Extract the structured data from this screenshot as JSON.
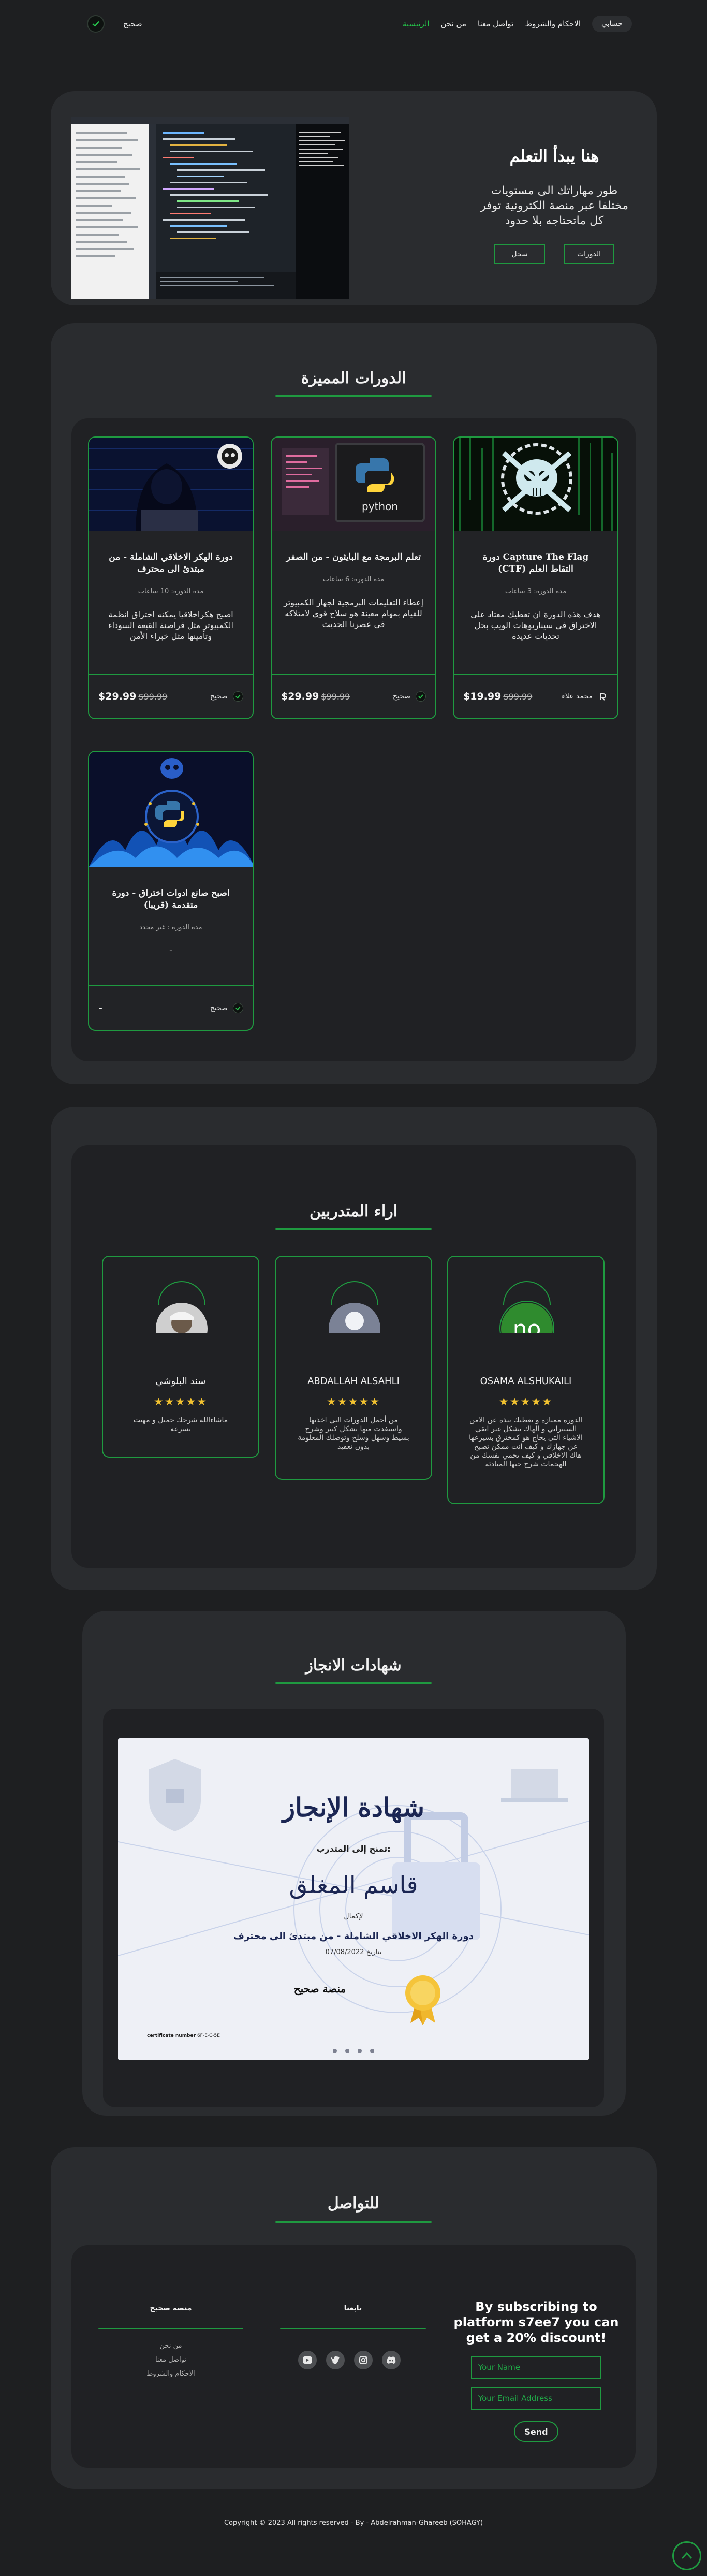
{
  "nav": {
    "brand_name": "صحيح",
    "links": [
      "الرئيسية",
      "من نحن",
      "تواصل معنا",
      "الاحكام والشروط"
    ],
    "account_label": "حسابي"
  },
  "hero": {
    "title": "هنا يبدأ التعلم",
    "description": "طور مهاراتك الى مستويات مختلفا عبر منصة الكترونية توفر كل ماتحتاجه بلا حدود",
    "register_label": "سجل",
    "courses_label": "الدورات"
  },
  "featured": {
    "title": "الدورات المميزة",
    "courses": [
      {
        "title": "دورة Capture The Flag (CTF) التقاط العلم",
        "duration": "مدة الدورة: 3 ساعات",
        "description": "هدف هذه الدورة ان تعطيك معتاد على الاختراق في سيناريوهات الويب بحل تحديات عديدة",
        "price": "$19.99",
        "old_price": "$99.99",
        "author": "محمد علاء"
      },
      {
        "title": "تعلم البرمجة مع البايثون - من الصفر",
        "duration": "مدة الدورة: 6 ساعات",
        "description": "إعطاء التعليمات البرمجية لجهاز الكمبيوتر للقيام بمهام معينة هو سلاح قوي لامتلاكه في عصرنا الحديث",
        "price": "$29.99",
        "old_price": "$99.99",
        "author": "صحيح"
      },
      {
        "title": "دورة الهكر الاخلاقي الشاملة - من مبتدئ الى محترف",
        "duration": "مدة الدورة: 10 ساعات",
        "description": "اصبح هكراخلاقيا يمكنه اختراق انظمة الكمبيوتر مثل قراصنة القبعة السوداء وتأمينها مثل خبراء الأمن",
        "price": "$29.99",
        "old_price": "$99.99",
        "author": "صحيح"
      },
      {
        "title": "اصبح صانع ادوات اختراق - دورة متقدمة (قريبا)",
        "duration": "مدة الدورة : غير محدد",
        "description": "-",
        "price": "-",
        "old_price": "",
        "author": "صحيح"
      }
    ]
  },
  "reviews": {
    "title": "اراء المتدربين",
    "items": [
      {
        "name": "OSAMA ALSHUKAILI",
        "avatar_text": "no",
        "stars": "★★★★★",
        "text": "الدورة ممتازة و تعطيك نبذه عن الامن السيبراني و الهاك بشكل غير ابقي الاشياء التي يحاج هو كمخترق بسيرعها عن جهازك و كيف انت ممكن تصبح هاك الاخلاقي و كيف تحمي نفسك من الهجمات شرح جيها المبادئة"
      },
      {
        "name": "ABDALLAH ALSAHLI",
        "avatar_text": "",
        "stars": "★★★★★",
        "text": "من أجمل الدورات التي اخذتها واستفدت منها بشكل كبير وشرح بسيط وسهل وسلخ وتوصلك المعلومة بدون تعقيد"
      },
      {
        "name": "سند البلوشي",
        "avatar_text": "",
        "stars": "★★★★★",
        "text": "ماشاءالله شرحك جميل و مهيت بسرعه"
      }
    ]
  },
  "certificates": {
    "title": "شهادات الانجاز",
    "cert_heading": "شهادة الإنجاز",
    "granted_to": "تمنح إلى المتدرب:",
    "trainee_name": "قاسم المغلق",
    "for_completing": "لإكمال",
    "course_name": "دورة الهكر الاخلاقي الشاملة - من مبتدئ الى محترف",
    "date_label": "بتاريخ",
    "date": "07/08/2022",
    "platform": "منصة صحيح",
    "certificate_number_label": "certificate number",
    "certificate_number": "6F-E-C-5E"
  },
  "contact": {
    "title": "للتواصل",
    "platform_col_title": "منصة صحيح",
    "platform_links": [
      "من نحن",
      "تواصل معنا",
      "الاحكام والشروط"
    ],
    "follow_col_title": "تابعنا",
    "social_icons": [
      "youtube-icon",
      "twitter-icon",
      "instagram-icon",
      "discord-icon"
    ],
    "subscribe_text": "By subscribing to platform s7ee7 you can get a 20% discount!",
    "name_placeholder": "Your Name",
    "email_placeholder": "Your Email Address",
    "send_label": "Send"
  },
  "footer": {
    "copyright": "Copyright © 2023 All rights reserved - By - Abdelrahman-Ghareeb (SOHAGY)"
  },
  "colors": {
    "accent": "#1f9a40",
    "background": "#1e1f21",
    "panel": "#2a2c2f",
    "star": "#f2c230"
  }
}
